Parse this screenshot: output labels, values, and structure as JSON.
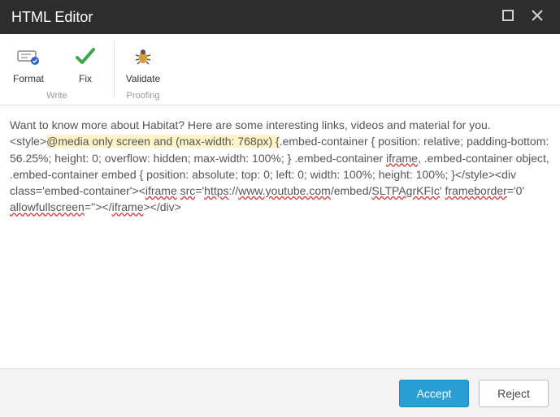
{
  "title": "HTML Editor",
  "toolbar": {
    "group_write": {
      "label": "Write",
      "format_label": "Format",
      "fix_label": "Fix"
    },
    "group_proofing": {
      "label": "Proofing",
      "validate_label": "Validate"
    }
  },
  "editor": {
    "leading_text": "Want to know more about Habitat? Here are some interesting links, videos and material for you. <style>",
    "highlighted": "@media only screen and (max-width: 768px) {",
    "middle_1": ".embed-container { position: relative; padding-bottom: 56.25%; height: 0; overflow: hidden; max-width: 100%; } .embed-container ",
    "wavy_iframe1": "iframe",
    "middle_2": ", .embed-container object, .embed-container embed { position: absolute; top: 0; left: 0; width: 100%; height: 100%; }</style><div class='embed-container'><",
    "wavy_iframe2": "iframe",
    "middle_3": " ",
    "wavy_src": "src",
    "middle_4": "='",
    "wavy_url1": "https",
    "middle_5": "://",
    "wavy_url2": "www.youtube.com",
    "middle_6": "/embed/",
    "wavy_url3": "SLTPAgrKFIc",
    "middle_7": "' ",
    "wavy_fb": "frameborder",
    "middle_8": "='0' ",
    "wavy_afs": "allowfullscreen",
    "middle_9": "=''></",
    "wavy_iframe3": "iframe",
    "trailing_text": "></div>"
  },
  "footer": {
    "accept_label": "Accept",
    "reject_label": "Reject"
  }
}
